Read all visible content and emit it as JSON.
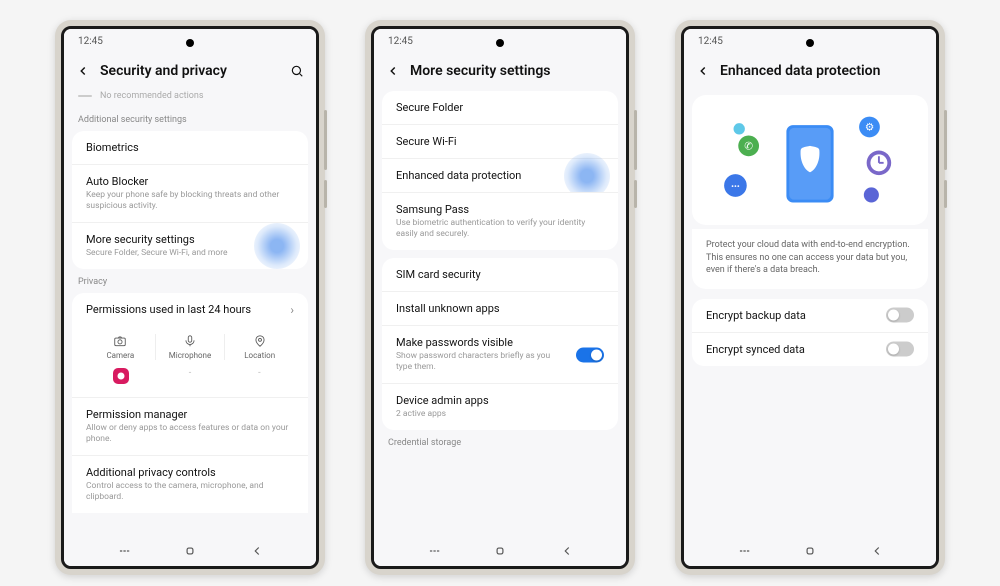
{
  "time": "12:45",
  "screen1": {
    "title": "Security and privacy",
    "recommend": "No recommended actions",
    "sec_label": "Additional security settings",
    "biometrics": "Biometrics",
    "auto_blocker": "Auto Blocker",
    "auto_blocker_sub": "Keep your phone safe by blocking threats and other suspicious activity.",
    "more_sec": "More security settings",
    "more_sec_sub": "Secure Folder, Secure Wi-Fi, and more",
    "privacy_label": "Privacy",
    "perms_24h": "Permissions used in last 24 hours",
    "camera": "Camera",
    "microphone": "Microphone",
    "location": "Location",
    "perm_mgr": "Permission manager",
    "perm_mgr_sub": "Allow or deny apps to access features or data on your phone.",
    "add_priv": "Additional privacy controls",
    "add_priv_sub": "Control access to the camera, microphone, and clipboard."
  },
  "screen2": {
    "title": "More security settings",
    "secure_folder": "Secure Folder",
    "secure_wifi": "Secure Wi-Fi",
    "enhanced": "Enhanced data protection",
    "samsung_pass": "Samsung Pass",
    "samsung_pass_sub": "Use biometric authentication to verify your identity easily and securely.",
    "sim": "SIM card security",
    "unknown_apps": "Install unknown apps",
    "make_pw": "Make passwords visible",
    "make_pw_sub": "Show password characters briefly as you type them.",
    "device_admin": "Device admin apps",
    "device_admin_sub": "2 active apps",
    "cred_storage": "Credential storage"
  },
  "screen3": {
    "title": "Enhanced data protection",
    "desc": "Protect your cloud data with end-to-end encryption. This ensures no one can access your data but you, even if there's a data breach.",
    "encrypt_backup": "Encrypt backup data",
    "encrypt_synced": "Encrypt synced data"
  }
}
